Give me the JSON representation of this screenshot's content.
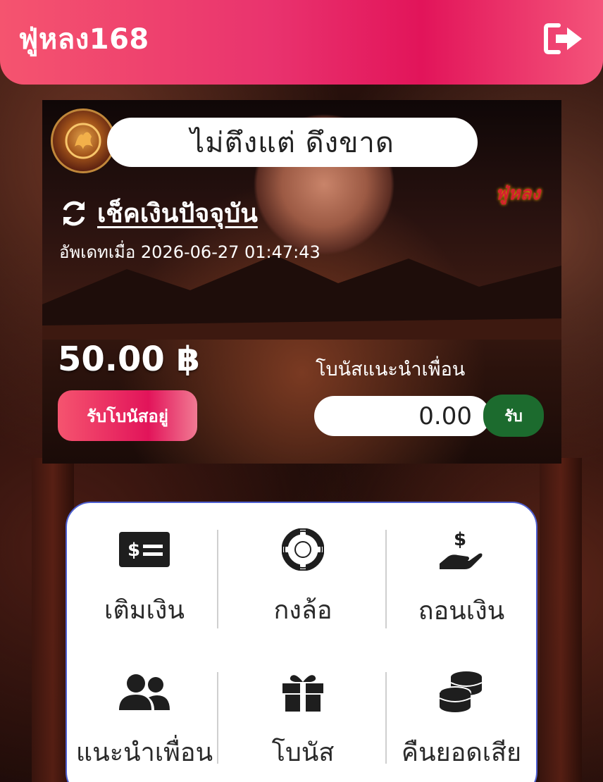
{
  "header": {
    "brand": "ฟู่หลง168",
    "logout_icon": "sign-out-icon"
  },
  "hero": {
    "slogan": "ไม่ตึงแต่ ดึงขาด",
    "mini_logo_text": "ฟู่หลง",
    "check_balance_label": "เช็คเงินปัจจุบัน",
    "updated_text": "อัพเดทเมื่อ 2026-06-27 01:47:43",
    "balance": "50.00 ฿",
    "bonus_referral_label": "โบนัสแนะนำเพื่อน",
    "claim_bonus_button": "รับโบนัสอยู่",
    "referral_amount": "0.00",
    "receive_button": "รับ"
  },
  "menu": {
    "items": [
      {
        "label": "เติมเงิน",
        "icon": "money-bill-icon"
      },
      {
        "label": "กงล้อ",
        "icon": "life-ring-icon"
      },
      {
        "label": "ถอนเงิน",
        "icon": "hand-dollar-icon"
      },
      {
        "label": "แนะนำเพื่อน",
        "icon": "users-icon"
      },
      {
        "label": "โบนัส",
        "icon": "gift-icon"
      },
      {
        "label": "คืนยอดเสีย",
        "icon": "coins-icon"
      }
    ]
  },
  "colors": {
    "header_gradient_start": "#f5546f",
    "header_gradient_mid": "#e2145a",
    "receive_green": "#1c6b2e",
    "menu_border": "#4d5fd1"
  }
}
